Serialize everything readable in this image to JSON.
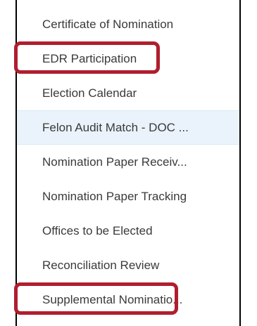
{
  "menu": {
    "items": [
      {
        "label": "Certificate of Nomination",
        "highlighted": false,
        "hovered": false
      },
      {
        "label": "EDR Participation",
        "highlighted": true,
        "hovered": false
      },
      {
        "label": "Election Calendar",
        "highlighted": false,
        "hovered": false
      },
      {
        "label": "Felon Audit Match - DOC ...",
        "highlighted": false,
        "hovered": true
      },
      {
        "label": "Nomination Paper Receiv...",
        "highlighted": false,
        "hovered": false
      },
      {
        "label": "Nomination Paper Tracking",
        "highlighted": false,
        "hovered": false
      },
      {
        "label": "Offices to be Elected",
        "highlighted": false,
        "hovered": false
      },
      {
        "label": "Reconciliation Review",
        "highlighted": true,
        "hovered": false
      },
      {
        "label": "Supplemental Nominatio...",
        "highlighted": false,
        "hovered": false
      }
    ]
  },
  "colors": {
    "highlight_box": "#b01e2e",
    "hover_background": "#eaf3fb",
    "text": "#3a3a3a"
  }
}
